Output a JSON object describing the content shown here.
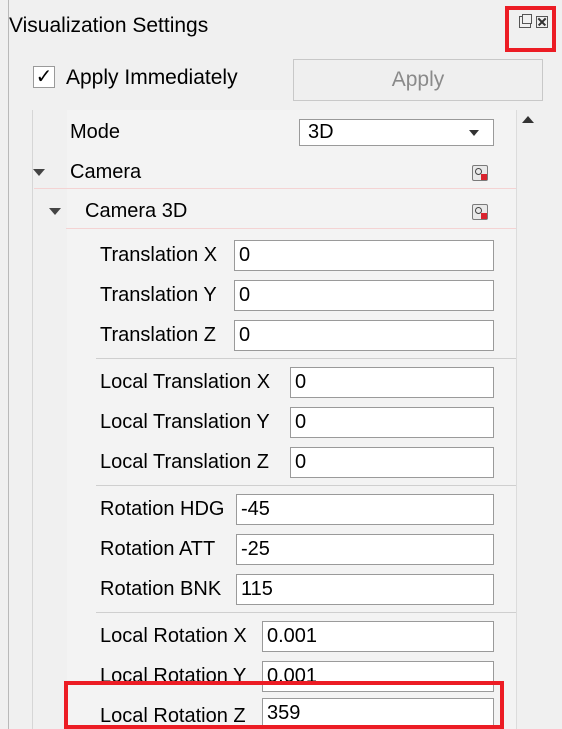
{
  "window": {
    "title": "Visualization Settings",
    "float_icon": "float-icon",
    "close_icon": "close-icon"
  },
  "toolbar": {
    "apply_immediately_label": "Apply Immediately",
    "apply_immediately_checked": "✓",
    "apply_button": "Apply"
  },
  "tree": {
    "mode_label": "Mode",
    "mode_value": "3D",
    "camera_label": "Camera",
    "camera3d_label": "Camera 3D",
    "fields": [
      {
        "label": "Translation X",
        "value": "0"
      },
      {
        "label": "Translation Y",
        "value": "0"
      },
      {
        "label": "Translation Z",
        "value": "0"
      },
      {
        "label": "Local Translation X",
        "value": "0"
      },
      {
        "label": "Local Translation Y",
        "value": "0"
      },
      {
        "label": "Local Translation Z",
        "value": "0"
      },
      {
        "label": "Rotation HDG",
        "value": "-45"
      },
      {
        "label": "Rotation ATT",
        "value": "-25"
      },
      {
        "label": "Rotation BNK",
        "value": "115"
      },
      {
        "label": "Local Rotation X",
        "value": "0.001"
      },
      {
        "label": "Local Rotation Y",
        "value": "0.001"
      },
      {
        "label": "Local Rotation Z",
        "value": "359"
      }
    ]
  },
  "colors": {
    "highlight": "#ec1c24",
    "panel_bg": "#f0f0f0"
  }
}
